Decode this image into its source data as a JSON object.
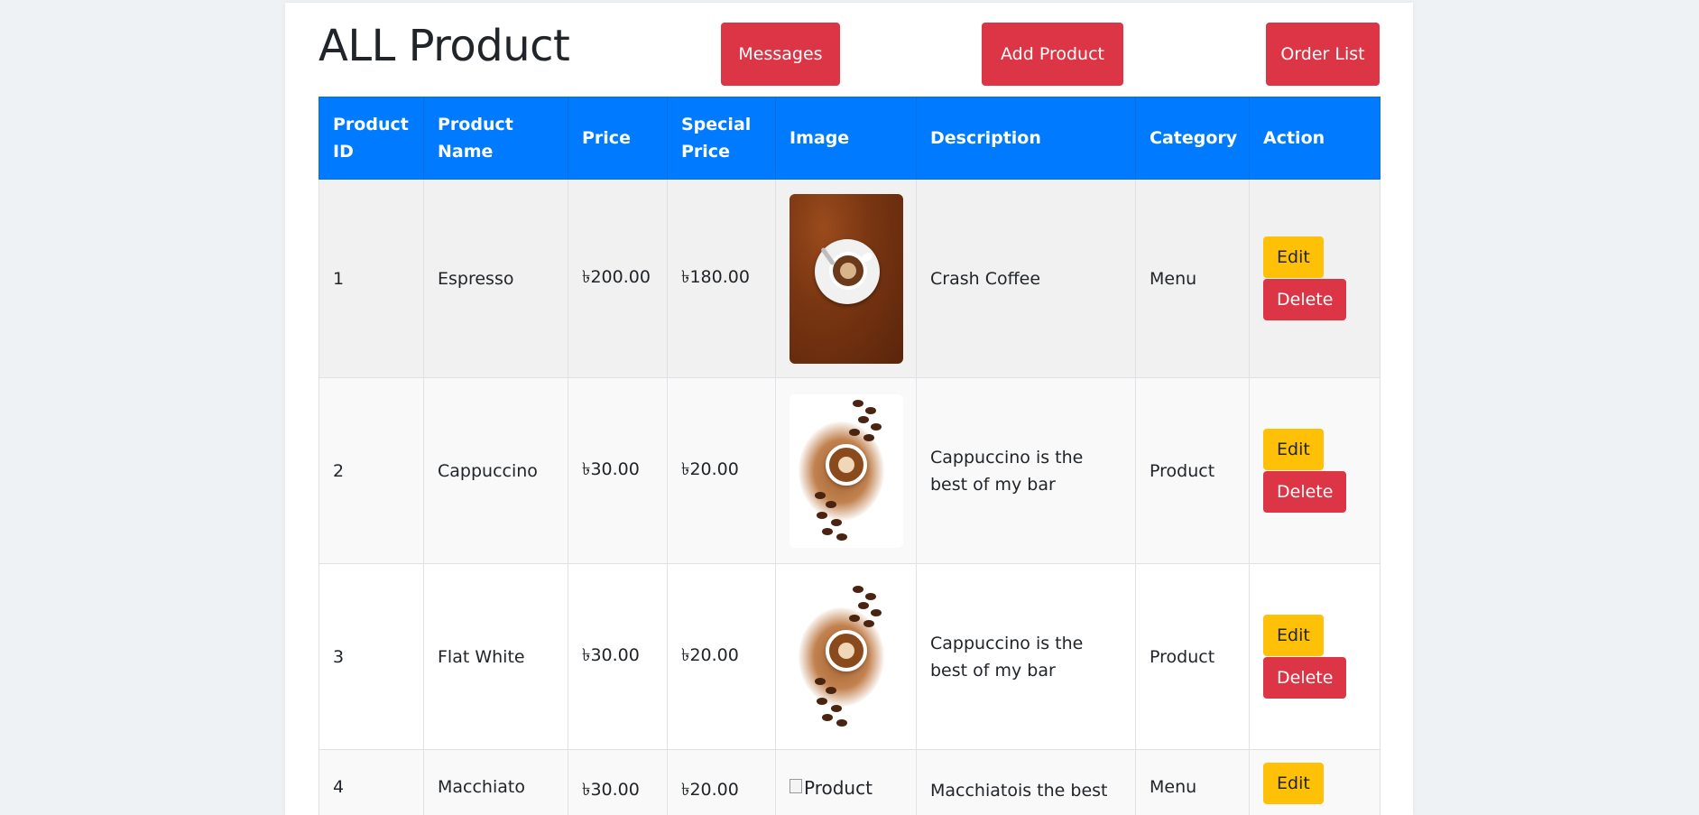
{
  "page": {
    "title": "ALL Product"
  },
  "header_buttons": {
    "messages": "Messages",
    "add_product": "Add Product",
    "order_list": "Order List"
  },
  "table": {
    "columns": [
      "Product ID",
      "Product Name",
      "Price",
      "Special Price",
      "Image",
      "Description",
      "Category",
      "Action"
    ],
    "rows": [
      {
        "id": "1",
        "name": "Espresso",
        "price": "৳200.00",
        "special": "৳180.00",
        "image_alt": "",
        "description": "Crash Coffee",
        "category": "Menu"
      },
      {
        "id": "2",
        "name": "Cappuccino",
        "price": "৳30.00",
        "special": "৳20.00",
        "image_alt": "",
        "description": "Cappuccino is the best of my bar",
        "category": "Product"
      },
      {
        "id": "3",
        "name": "Flat White",
        "price": "৳30.00",
        "special": "৳20.00",
        "image_alt": "",
        "description": "Cappuccino is the best of my bar",
        "category": "Product"
      },
      {
        "id": "4",
        "name": "Macchiato",
        "price": "৳30.00",
        "special": "৳20.00",
        "image_alt": "Product",
        "description": "Macchiatois the best",
        "category": "Menu"
      }
    ],
    "action_edit": "Edit",
    "action_delete": "Delete"
  },
  "colors": {
    "header_bg": "#007bff",
    "danger": "#dc3545",
    "warning": "#ffc107"
  },
  "icons": {
    "broken_image": "broken-image-icon"
  }
}
